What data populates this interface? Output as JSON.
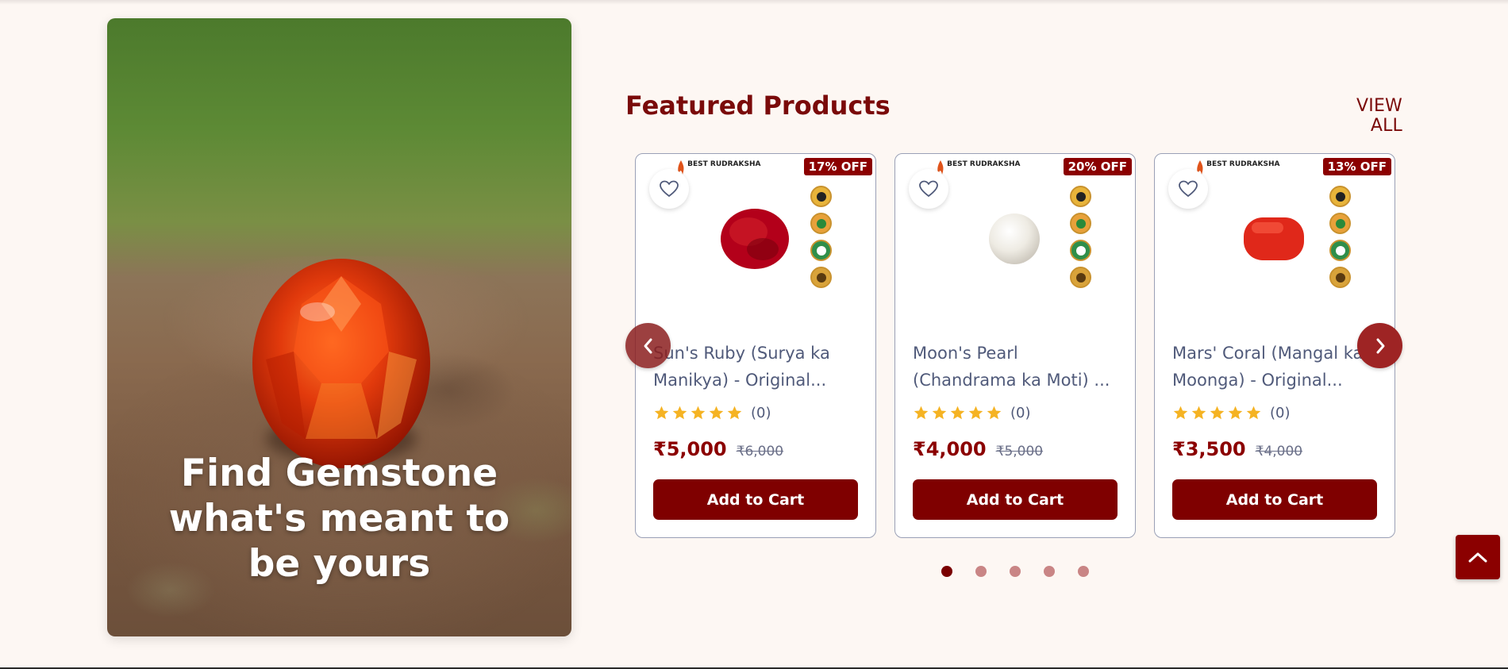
{
  "hero": {
    "title": "Find Gemstone what's meant to be yours"
  },
  "featured": {
    "title": "Featured Products",
    "view_all": "VIEW ALL",
    "products": [
      {
        "logo_text": "BEST RUDRAKSHA",
        "discount": "17% OFF",
        "name": "Sun's Ruby (Surya ka Manikya) - Original...",
        "rating_count": "(0)",
        "price": "₹5,000",
        "original_price": "₹6,000",
        "cart_label": "Add to Cart",
        "gem_color": "#b3001a"
      },
      {
        "logo_text": "BEST RUDRAKSHA",
        "discount": "20% OFF",
        "name": "Moon's Pearl (Chandrama ka Moti) ...",
        "rating_count": "(0)",
        "price": "₹4,000",
        "original_price": "₹5,000",
        "cart_label": "Add to Cart",
        "gem_color": "#f2f0ea"
      },
      {
        "logo_text": "BEST RUDRAKSHA",
        "discount": "13% OFF",
        "name": "Mars' Coral (Mangal ka Moonga) - Original...",
        "rating_count": "(0)",
        "price": "₹3,500",
        "original_price": "₹4,000",
        "cart_label": "Add to Cart",
        "gem_color": "#e0281a"
      }
    ],
    "pagination": {
      "total": 5,
      "active": 1
    }
  },
  "colors": {
    "brand": "#8b0000",
    "background": "#fdf7f3",
    "star": "#f5b323"
  },
  "icons": {
    "wishlist": "heart-outline-icon",
    "prev": "chevron-left-icon",
    "next": "chevron-right-icon",
    "back_to_top": "chevron-up-icon",
    "rating": "star-icon"
  }
}
